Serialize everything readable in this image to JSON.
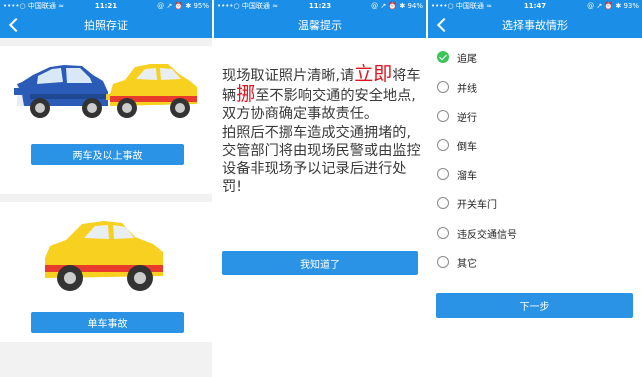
{
  "screen1": {
    "status": {
      "carrier": "••••○ 中国联通 ≈",
      "time": "11:21",
      "right": "@ ↗ ⏰ ✱ 95%"
    },
    "title": "拍照存证",
    "multi_car_button": "两车及以上事故",
    "single_car_button": "单车事故"
  },
  "screen2": {
    "status": {
      "carrier": "••••○ 中国联通 ≈",
      "time": "11:23",
      "right": "@ ↗ ⏰ ✱ 94%"
    },
    "title": "温馨提示",
    "text_parts": [
      "现场取证照片清晰,请",
      "立即",
      "将车辆",
      "挪",
      "至不影响交通的安全地点,双方协商确定事故责任。",
      "拍照后不挪车造成交通拥堵的,交管部门将由现场民警或由监控设备非现场予以记录后进行处罚!"
    ],
    "confirm_button": "我知道了"
  },
  "screen3": {
    "status": {
      "carrier": "••••○ 中国联通 ≈",
      "time": "11:47",
      "right": "@ ↗ ⏰ ✱ 93%"
    },
    "title": "选择事故情形",
    "options": [
      "追尾",
      "并线",
      "逆行",
      "倒车",
      "溜车",
      "开关车门",
      "违反交通信号",
      "其它"
    ],
    "selected_index": 0,
    "next_button": "下一步"
  }
}
